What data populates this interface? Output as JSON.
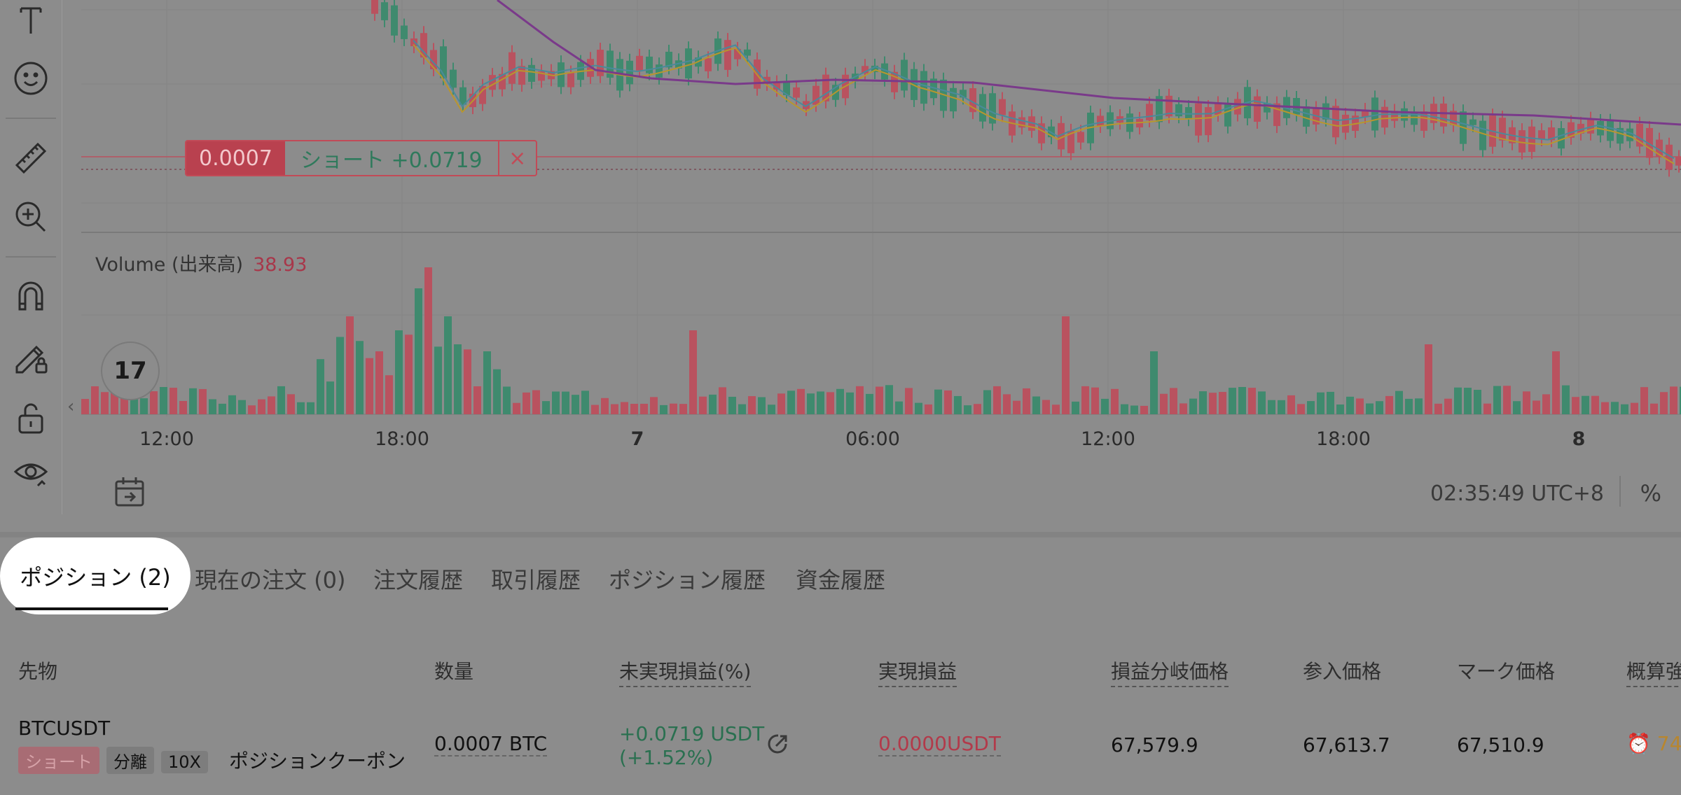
{
  "toolbar": {
    "tools": [
      "text-tool-icon",
      "emoji-icon",
      "ruler-icon",
      "zoom-in-icon",
      "magnet-icon",
      "pencil-lock-icon",
      "unlock-icon",
      "eye-icon"
    ]
  },
  "chart": {
    "position_tag": {
      "qty": "0.0007",
      "side_pnl": "ショート +0.0719",
      "close": "×"
    },
    "volume_label": "Volume (出来高)",
    "volume_value": "38.93",
    "logo": "17",
    "x_labels": [
      "12:00",
      "18:00",
      "7",
      "06:00",
      "12:00",
      "18:00",
      "8"
    ],
    "clock": "02:35:49 UTC+8",
    "percent": "%",
    "colors": {
      "up": "#3f8a6e",
      "down": "#b9525f",
      "ma_fast": "#b8962e",
      "ma_mid": "#4a8a9a",
      "ma_slow": "#7a3a8a"
    }
  },
  "tabs": {
    "active": "ポジション (2)",
    "items": [
      "現在の注文 (0)",
      "注文履歴",
      "取引履歴",
      "ポジション履歴",
      "資金履歴"
    ]
  },
  "table": {
    "headers": [
      "先物",
      "数量",
      "未実現損益(%)",
      "実現損益",
      "損益分岐価格",
      "参入価格",
      "マーク価格",
      "概算強"
    ],
    "row": {
      "symbol": "BTCUSDT",
      "side": "ショート",
      "margin": "分離",
      "leverage": "10X",
      "coupon": "ポジションクーポン",
      "qty": "0.0007 BTC",
      "upnl": "+0.0719 USDT",
      "upnl_pct": "(+1.52%)",
      "rpnl": "0.0000USDT",
      "breakeven": "67,579.9",
      "entry": "67,613.7",
      "mark": "67,510.9",
      "liq": "74"
    }
  }
}
